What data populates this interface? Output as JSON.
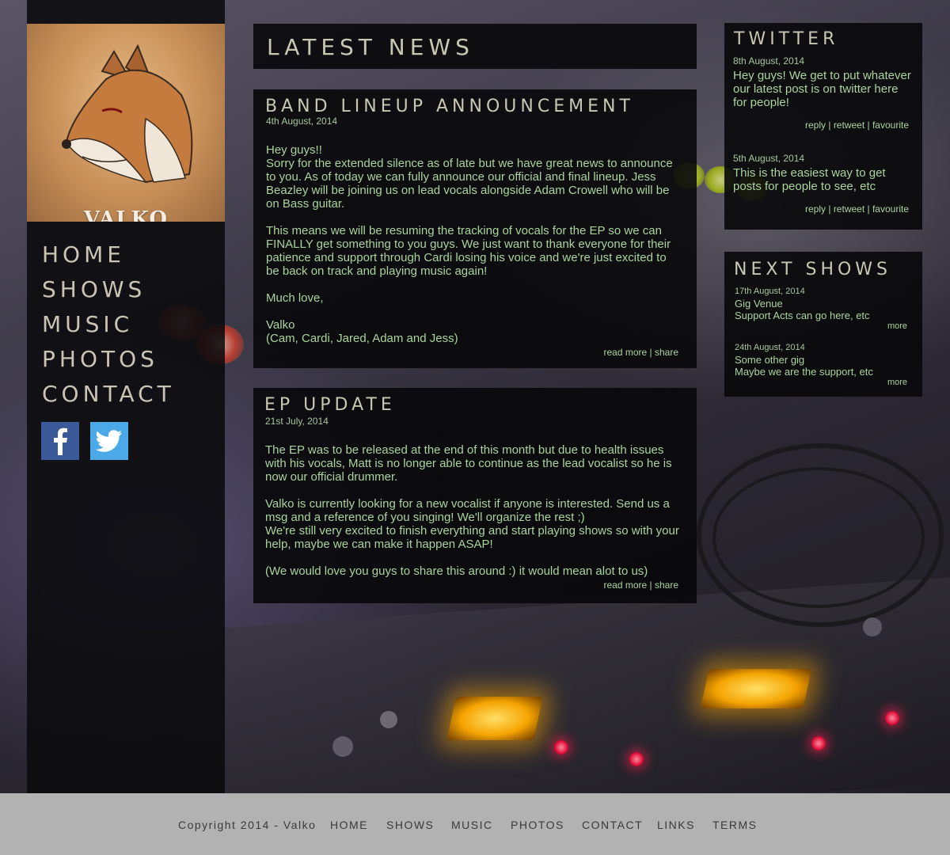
{
  "brand": {
    "logo_text": "VALKO"
  },
  "nav": {
    "items": [
      "HOME",
      "SHOWS",
      "MUSIC",
      "PHOTOS",
      "CONTACT"
    ]
  },
  "social": {
    "facebook_icon": "facebook-icon",
    "twitter_icon": "twitter-icon"
  },
  "latest_news": {
    "title": "LATEST NEWS"
  },
  "posts": [
    {
      "title": "BAND LINEUP ANNOUNCEMENT",
      "date": "4th August, 2014",
      "paragraphs": [
        "Hey guys!!",
        "Sorry for the extended silence as of late but we have great news to announce to you. As of today we can fully announce our official and final lineup. Jess Beazley will be joining us on lead vocals alongside Adam Crowell who will be on Bass guitar.",
        "",
        "This means we will be resuming the tracking of vocals for the EP so we can FINALLY get something to you guys. We just want to thank everyone for their patience and support through Cardi losing his voice and we're just excited to be back on track and playing music again!",
        "",
        "Much love,",
        "",
        "Valko",
        "(Cam, Cardi, Jared, Adam and Jess)"
      ],
      "read_more": "read more",
      "share": "share"
    },
    {
      "title": "EP UPDATE",
      "date": "21st July, 2014",
      "paragraphs": [
        "The EP was to be released at the end of this month but due to health issues with his vocals, Matt is no longer able to continue as the lead vocalist so he is now our official drummer.",
        "",
        "Valko is currently looking for a new vocalist if anyone is interested. Send us a msg and a reference of you singing! We'll organize the rest ;)",
        "We're still very excited to finish everything and start playing shows so with your help, maybe we can make it happen ASAP!",
        "",
        "(We would love you guys to share this around :) it would mean alot to us)"
      ],
      "read_more": "read more",
      "share": "share"
    }
  ],
  "twitter": {
    "title": "TWITTER",
    "tweets": [
      {
        "date": "8th August, 2014",
        "text": "Hey guys! We get to put whatever our latest post is on twitter here for people!"
      },
      {
        "date": "5th August, 2014",
        "text": "This is the easiest way to get posts for people to see, etc"
      }
    ],
    "actions": {
      "reply": "reply",
      "retweet": "retweet",
      "favourite": "favourite"
    }
  },
  "next_shows": {
    "title": "NEXT SHOWS",
    "shows": [
      {
        "date": "17th August, 2014",
        "venue": "Gig Venue",
        "support": "Support Acts can go here, etc",
        "more": "more"
      },
      {
        "date": "24th August, 2014",
        "venue": "Some other gig",
        "support": "Maybe we are the support, etc",
        "more": "more"
      }
    ]
  },
  "footer": {
    "copyright": "Copyright 2014 - Valko",
    "links": [
      "HOME",
      "SHOWS",
      "MUSIC",
      "PHOTOS",
      "CONTACT",
      "LINKS",
      "TERMS"
    ]
  }
}
